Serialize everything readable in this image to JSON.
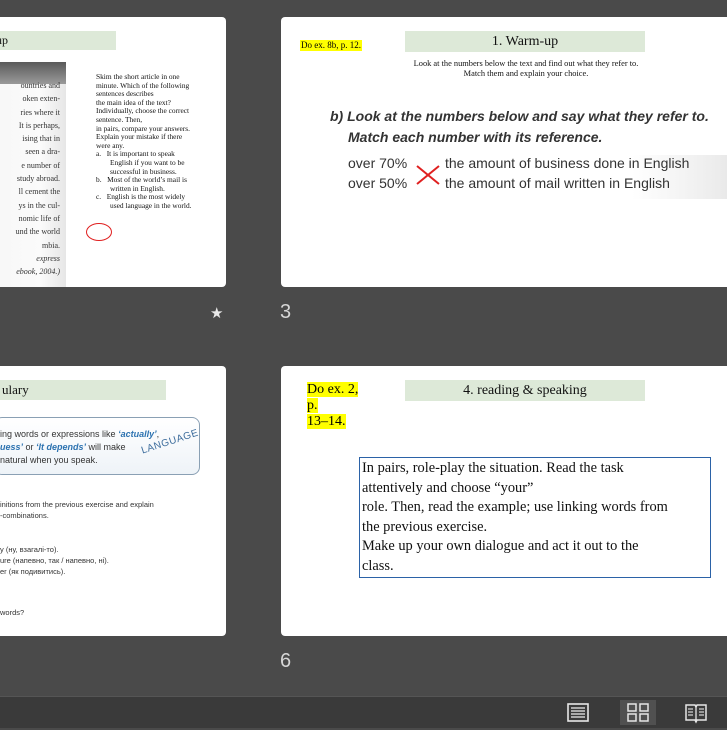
{
  "slide_numbers": {
    "s3": "3",
    "s6": "6"
  },
  "slide2": {
    "title_fragment": "n-up",
    "book_lines": [
      "ountries and",
      "oken exten-",
      "ries where it",
      "It is perhaps,",
      "ising that in",
      "seen a dra-",
      "e number of",
      "study abroad.",
      "ll cement the",
      "ys in the cul-",
      "nomic life of",
      "und the world",
      "mbia."
    ],
    "book_source_italic": [
      "express",
      "ebook, 2004.)"
    ],
    "task_lines": [
      "Skim the short article in one",
      "minute. Which of the following",
      "sentences describes",
      "the main idea of the text?",
      "Individually, choose the correct",
      "sentence. Then,",
      "in pairs, compare your answers.",
      "Explain your mistake if there",
      "were any."
    ],
    "options": [
      {
        "letter": "a.",
        "lines": [
          "It is important to speak",
          "English if you want to be",
          "successful in business."
        ]
      },
      {
        "letter": "b.",
        "lines": [
          "Most of the world’s mail is",
          "written in English."
        ]
      },
      {
        "letter": "c.",
        "lines": [
          "English is the most widely",
          "used language in the world."
        ]
      }
    ]
  },
  "slide3": {
    "homework": "Do ex. 8b, p. 12.",
    "title": "1. Warm-up",
    "instruction_line1": "Look at the numbers below the text and find out what they refer to.",
    "instruction_line2": "Match them and explain your choice.",
    "question_line1": "b) Look at the numbers below and say what they refer to.",
    "question_line2": "Match each number with its reference.",
    "rows": [
      {
        "number": "over 70%",
        "reference": "the amount of business done in English"
      },
      {
        "number": "over 50%",
        "reference": "the amount of mail written in English"
      }
    ]
  },
  "slide5": {
    "title_fragment": "ulary",
    "lang_line1_pre": "ing words or expressions like ",
    "lang_line1_q": "‘actually’",
    "lang_line1_post": ",",
    "lang_line2_q1": "uess’",
    "lang_line2_mid": " or ",
    "lang_line2_q2": "‘It depends’",
    "lang_line2_post": " will make",
    "lang_line3": "natural when you speak.",
    "lang_tag": "LANGUAGE",
    "small_lines_a": [
      "initions from the previous exercise and explain",
      "-combinations."
    ],
    "small_lines_b": [
      "y (ну, взагалі-то).",
      "ure (напевно, так / напевно, ні).",
      "er (як подивитись)."
    ],
    "small_line_c": "words?"
  },
  "slide6": {
    "homework_line1": "Do ex. 2, p.",
    "homework_line2": "13–14.",
    "title": "4. reading & speaking",
    "task_lines": [
      "In pairs, role-play the situation. Read the task",
      "attentively and choose “your”",
      "role. Then, read the example; use linking words from",
      "the previous exercise.",
      "Make up your own dialogue and act it out to the",
      "class."
    ]
  },
  "icons": {
    "transition": "star-icon",
    "normal_view": "normal-view-icon",
    "sorter_view": "slide-sorter-icon",
    "reading_view": "reading-view-icon"
  },
  "colors": {
    "background": "#4a4a4a",
    "title_fill": "#dde9d8",
    "highlight": "#ffff00",
    "cross": "#e02020",
    "task_border": "#2b62a7"
  }
}
